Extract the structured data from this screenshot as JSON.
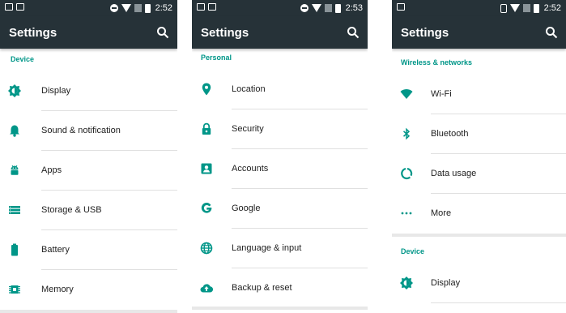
{
  "colors": {
    "accent": "#009688",
    "toolbar": "#263238"
  },
  "panels": [
    {
      "status_time": "2:52",
      "title": "Settings",
      "section": "Device",
      "items": [
        {
          "label": "Display",
          "icon": "brightness-icon"
        },
        {
          "label": "Sound & notification",
          "icon": "bell-icon"
        },
        {
          "label": "Apps",
          "icon": "android-icon"
        },
        {
          "label": "Storage & USB",
          "icon": "storage-icon"
        },
        {
          "label": "Battery",
          "icon": "battery-icon"
        },
        {
          "label": "Memory",
          "icon": "memory-icon"
        }
      ]
    },
    {
      "status_time": "2:53",
      "title": "Settings",
      "section": "Personal",
      "items": [
        {
          "label": "Location",
          "icon": "location-pin-icon"
        },
        {
          "label": "Security",
          "icon": "lock-icon"
        },
        {
          "label": "Accounts",
          "icon": "account-box-icon"
        },
        {
          "label": "Google",
          "icon": "google-icon"
        },
        {
          "label": "Language & input",
          "icon": "globe-icon"
        },
        {
          "label": "Backup & reset",
          "icon": "cloud-upload-icon"
        }
      ]
    },
    {
      "status_time": "2:52",
      "title": "Settings",
      "section": "Wireless & networks",
      "items": [
        {
          "label": "Wi-Fi",
          "icon": "wifi-icon"
        },
        {
          "label": "Bluetooth",
          "icon": "bluetooth-icon"
        },
        {
          "label": "Data usage",
          "icon": "data-usage-icon"
        },
        {
          "label": "More",
          "icon": "more-horiz-icon"
        }
      ],
      "section2": "Device",
      "items2": [
        {
          "label": "Display",
          "icon": "brightness-icon"
        }
      ]
    }
  ]
}
